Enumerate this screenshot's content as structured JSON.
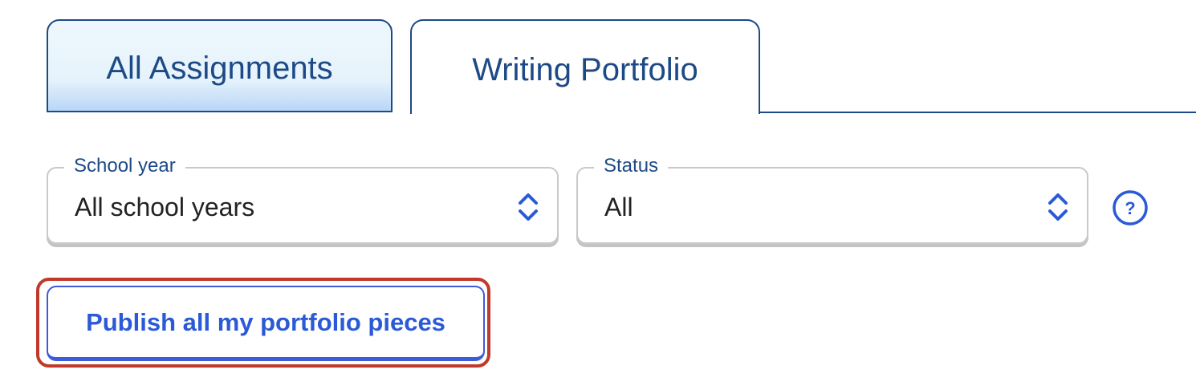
{
  "tabs": [
    {
      "label": "All Assignments",
      "active": false
    },
    {
      "label": "Writing Portfolio",
      "active": true
    }
  ],
  "filters": {
    "school_year": {
      "label": "School year",
      "value": "All school years"
    },
    "status": {
      "label": "Status",
      "value": "All"
    }
  },
  "help": {
    "glyph": "?"
  },
  "publish_button": {
    "label": "Publish all my portfolio pieces"
  },
  "colors": {
    "primary": "#1d4a86",
    "accent": "#2b5ad6",
    "highlight": "#c0392b"
  }
}
